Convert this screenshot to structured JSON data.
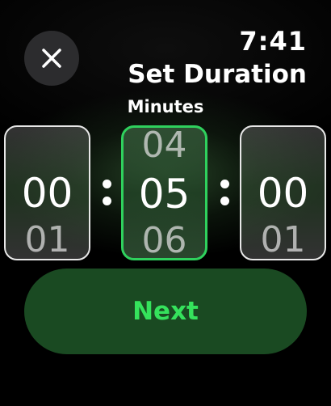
{
  "status": {
    "time": "7:41"
  },
  "header": {
    "title": "Set Duration",
    "close_icon": "close-icon"
  },
  "picker": {
    "active_label": "Minutes",
    "hours": {
      "prev": "",
      "current": "00",
      "next": "01"
    },
    "minutes": {
      "prev": "04",
      "current": "05",
      "next": "06"
    },
    "seconds": {
      "prev": "",
      "current": "00",
      "next": "01"
    }
  },
  "actions": {
    "next_label": "Next"
  },
  "colors": {
    "accent": "#35e25c",
    "selected_border": "#2fd15d",
    "button_bg": "#1a4a22"
  }
}
